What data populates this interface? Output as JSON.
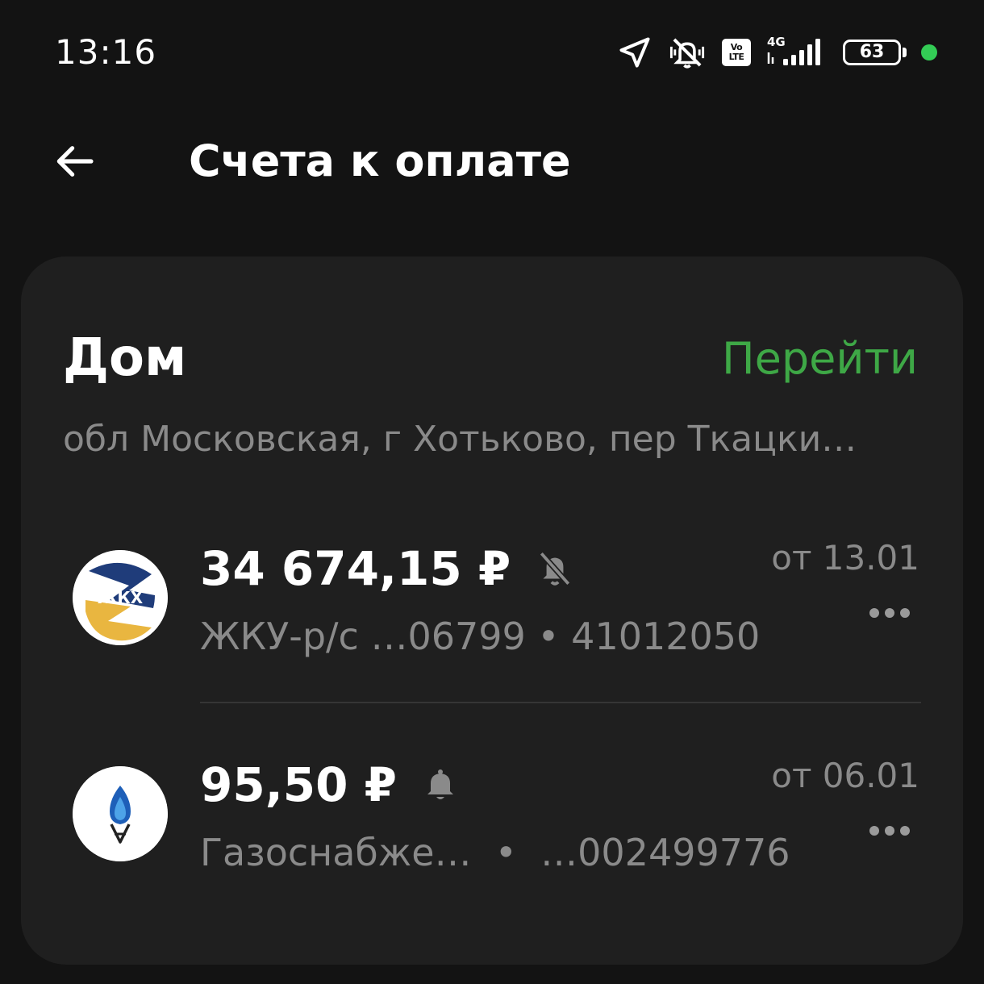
{
  "status_bar": {
    "time": "13:16",
    "volte_top": "Vo",
    "volte_bottom": "LTE",
    "network": "4G",
    "battery_level": "63",
    "battery_fraction": 0.63,
    "icons": [
      "location-arrow-icon",
      "vibrate-muted-icon",
      "volte-icon",
      "signal-icon",
      "battery-icon"
    ]
  },
  "header": {
    "title": "Счета к оплате",
    "back_icon": "arrow-left-icon"
  },
  "card": {
    "title": "Дом",
    "link_label": "Перейти",
    "address": "обл Московская, г Хотьково, пер Ткацки…",
    "bills": [
      {
        "amount": "34 674,15 ₽",
        "desc_name": "ЖКУ-р/с …06799",
        "desc_sep": " • ",
        "desc_account": "41012050",
        "date": "от 13.01",
        "logo_text": "ЖКХ",
        "notification_icon": "bell-off-icon"
      },
      {
        "amount": "95,50 ₽",
        "desc_name": "Газоснабже…",
        "desc_sep": "  •  ",
        "desc_account": "…002499776",
        "date": "от 06.01",
        "notification_icon": "bell-icon"
      }
    ]
  },
  "colors": {
    "background": "#131313",
    "card": "#1f1f1f",
    "accent_green": "#3ea846",
    "secondary_text": "#8a8a8a",
    "status_dot": "#33cc55"
  }
}
